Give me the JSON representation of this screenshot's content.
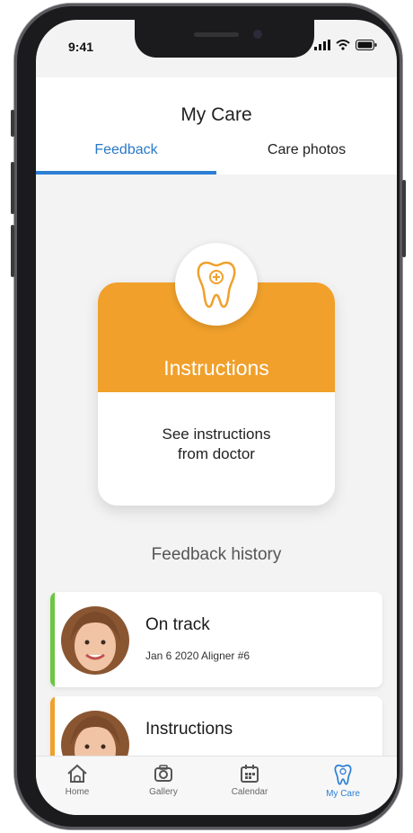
{
  "status_bar": {
    "time": "9:41"
  },
  "header": {
    "title": "My Care"
  },
  "tabs": [
    {
      "label": "Feedback",
      "active": true
    },
    {
      "label": "Care photos",
      "active": false
    }
  ],
  "instructions_card": {
    "title": "Instructions",
    "description_line1": "See instructions",
    "description_line2": "from doctor",
    "icon": "tooth-icon",
    "color": "#f0a02b"
  },
  "feedback_history": {
    "title": "Feedback history",
    "items": [
      {
        "title": "On track",
        "subtitle": "Jan 6 2020 Aligner #6",
        "accent_color": "#6cc644",
        "icon": "avatar"
      },
      {
        "title": "Instructions",
        "subtitle": "",
        "accent_color": "#f0a02b",
        "icon": "avatar"
      }
    ]
  },
  "bottom_nav": [
    {
      "label": "Home",
      "icon": "home-icon",
      "active": false
    },
    {
      "label": "Gallery",
      "icon": "camera-icon",
      "active": false
    },
    {
      "label": "Calendar",
      "icon": "calendar-icon",
      "active": false
    },
    {
      "label": "My Care",
      "icon": "tooth-icon",
      "active": true
    }
  ],
  "colors": {
    "accent_blue": "#2b7fd4",
    "orange": "#f0a02b",
    "green": "#6cc644"
  }
}
